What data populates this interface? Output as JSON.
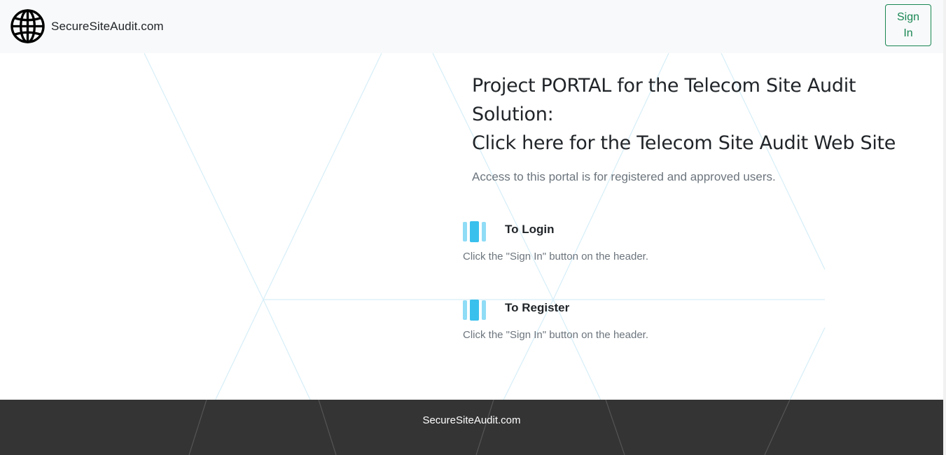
{
  "header": {
    "brand_name": "SecureSiteAudit.com",
    "brand_icon": "globe-icon",
    "signin_label": "Sign In"
  },
  "main": {
    "headline_line1": "Project PORTAL for the Telecom Site Audit Solution:",
    "headline_link": "Click here for the Telecom Site Audit Web Site",
    "lead": "Access to this portal is for registered and approved users.",
    "features": [
      {
        "icon": "columns-icon",
        "title": "To Login",
        "text": "Click the \"Sign In\" button on the header."
      },
      {
        "icon": "columns-icon",
        "title": "To Register",
        "text": "Click the \"Sign In\" button on the header."
      }
    ]
  },
  "footer": {
    "text": "SecureSiteAudit.com"
  },
  "colors": {
    "accent_green": "#198754",
    "icon_blue": "#39c0ed",
    "footer_bg": "#343434",
    "header_bg": "#f8f9fa"
  }
}
